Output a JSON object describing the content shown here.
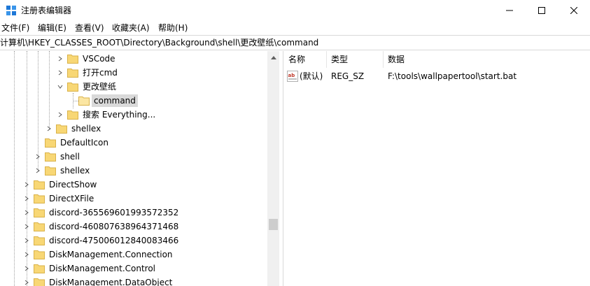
{
  "window": {
    "title": "注册表编辑器"
  },
  "menu": [
    {
      "label": "文件(F)"
    },
    {
      "label": "编辑(E)"
    },
    {
      "label": "查看(V)"
    },
    {
      "label": "收藏夹(A)"
    },
    {
      "label": "帮助(H)"
    }
  ],
  "address": {
    "path": "计算机\\HKEY_CLASSES_ROOT\\Directory\\Background\\shell\\更改壁纸\\command"
  },
  "tree": {
    "items": [
      {
        "label": "VSCode",
        "expandable": true,
        "expanded": false,
        "selected": false
      },
      {
        "label": "打开cmd",
        "expandable": true,
        "expanded": false,
        "selected": false
      },
      {
        "label": "更改壁纸",
        "expandable": true,
        "expanded": true,
        "selected": false
      },
      {
        "label": "command",
        "expandable": false,
        "expanded": false,
        "selected": true
      },
      {
        "label": "搜索 Everything...",
        "expandable": true,
        "expanded": false,
        "selected": false
      },
      {
        "label": "shellex",
        "expandable": true,
        "expanded": false,
        "selected": false
      },
      {
        "label": "DefaultIcon",
        "expandable": false,
        "expanded": false,
        "selected": false
      },
      {
        "label": "shell",
        "expandable": true,
        "expanded": false,
        "selected": false
      },
      {
        "label": "shellex",
        "expandable": true,
        "expanded": false,
        "selected": false
      },
      {
        "label": "DirectShow",
        "expandable": true,
        "expanded": false,
        "selected": false
      },
      {
        "label": "DirectXFile",
        "expandable": true,
        "expanded": false,
        "selected": false
      },
      {
        "label": "discord-365569601993572352",
        "expandable": true,
        "expanded": false,
        "selected": false
      },
      {
        "label": "discord-460807638964371468",
        "expandable": true,
        "expanded": false,
        "selected": false
      },
      {
        "label": "discord-475006012840083466",
        "expandable": true,
        "expanded": false,
        "selected": false
      },
      {
        "label": "DiskManagement.Connection",
        "expandable": true,
        "expanded": false,
        "selected": false
      },
      {
        "label": "DiskManagement.Control",
        "expandable": true,
        "expanded": false,
        "selected": false
      },
      {
        "label": "DiskManagement.DataObject",
        "expandable": true,
        "expanded": false,
        "selected": false
      }
    ]
  },
  "values": {
    "headers": {
      "name": "名称",
      "type": "类型",
      "data": "数据"
    },
    "rows": [
      {
        "name": "(默认)",
        "type": "REG_SZ",
        "data": "F:\\tools\\wallpapertool\\start.bat",
        "icon": "reg-string-icon"
      }
    ]
  },
  "colors": {
    "folder": "#f8d775",
    "selection": "#d9d9d9",
    "scroll_track": "#f0f0f0",
    "scroll_thumb": "#cdcdcd"
  }
}
